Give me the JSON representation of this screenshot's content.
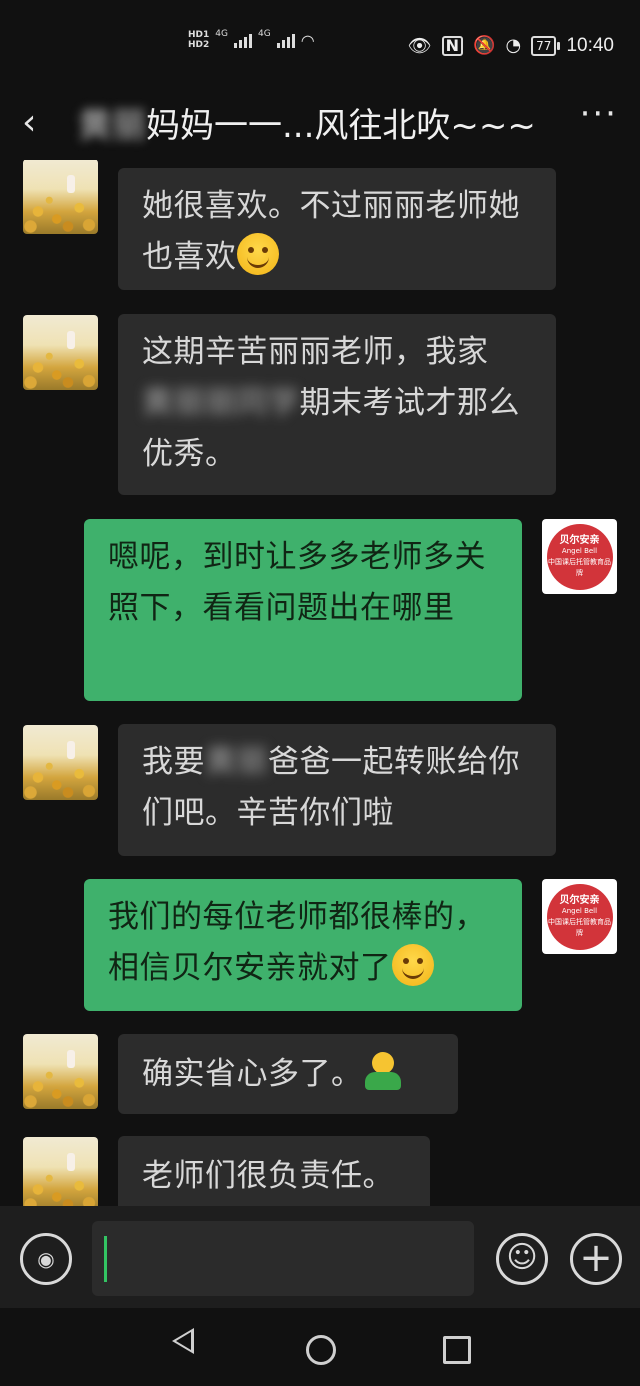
{
  "status_bar": {
    "hd1": "HD",
    "hd1_sub": "1",
    "hd2": "HD",
    "hd2_sub": "2",
    "net1": "4G",
    "net2": "4G",
    "battery": "77",
    "time": "10:40"
  },
  "header": {
    "title_prefix": "黄丽",
    "title_suffix": "妈妈一一...风往北吹~~~",
    "back_icon": "chevron-left-icon",
    "more_icon": "more-icon"
  },
  "messages": [
    {
      "side": "left",
      "text": "她很喜欢。不过丽丽老师她也喜欢",
      "emoji": "smile-emoji"
    },
    {
      "side": "left",
      "line1": "这期辛苦丽丽老师，我家",
      "blur": "黄丽丽同学",
      "line2": "期末考试才那么优秀。"
    },
    {
      "side": "right",
      "text": "嗯呢，到时让多多老师多关照下，看看问题出在哪里"
    },
    {
      "side": "left",
      "line1": "我要",
      "blur": "黄丽",
      "line2": "爸爸一起转账给你们吧。辛苦你们啦"
    },
    {
      "side": "right",
      "text": "我们的每位老师都很棒的，相信贝尔安亲就对了",
      "emoji": "smile-emoji"
    },
    {
      "side": "left",
      "text": "确实省心多了。",
      "emoji": "hug-emoji"
    },
    {
      "side": "left",
      "text": "老师们很负责任。"
    }
  ],
  "logo": {
    "name_cn": "贝尔安亲",
    "name_en": "Angel Bell",
    "tagline": "中国课后托管教育品牌"
  },
  "input_bar": {
    "value": "",
    "placeholder": ""
  },
  "colors": {
    "background": "#111111",
    "bubble_left": "#2c2c2c",
    "bubble_right": "#3fb16c",
    "caret": "#33c463",
    "logo_red": "#d2343a"
  }
}
